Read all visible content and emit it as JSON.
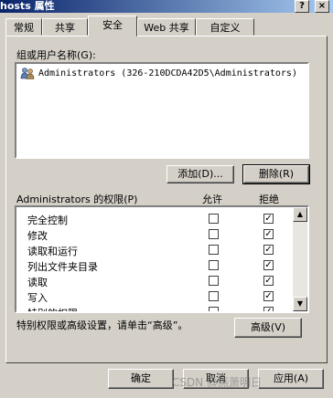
{
  "window": {
    "title": "hosts 属性",
    "help_btn": "?",
    "close_btn": "×"
  },
  "tabs": [
    "常规",
    "共享",
    "安全",
    "Web 共享",
    "自定义"
  ],
  "users_section": {
    "label": "组或用户名称(G):",
    "items": [
      {
        "name": "Administrators (326-210DCDA42D5\\Administrators)"
      }
    ],
    "add_label": "添加(D)...",
    "remove_label": "删除(R)"
  },
  "perm_section": {
    "label": "Administrators 的权限(P)",
    "allow_header": "允许",
    "deny_header": "拒绝",
    "rows": [
      {
        "name": "完全控制",
        "allow": false,
        "deny": true
      },
      {
        "name": "修改",
        "allow": false,
        "deny": true
      },
      {
        "name": "读取和运行",
        "allow": false,
        "deny": true
      },
      {
        "name": "列出文件夹目录",
        "allow": false,
        "deny": true
      },
      {
        "name": "读取",
        "allow": false,
        "deny": true
      },
      {
        "name": "写入",
        "allow": false,
        "deny": true
      },
      {
        "name": "特别的权限",
        "allow": false,
        "deny": true
      }
    ]
  },
  "advanced": {
    "hint": "特别权限或高级设置，请单击“高级”。",
    "button_label": "高级(V)"
  },
  "footer": {
    "ok_label": "确定",
    "cancel_label": "取消",
    "apply_label": "应用(A)"
  },
  "watermark": "CSDN @燕萧明日"
}
